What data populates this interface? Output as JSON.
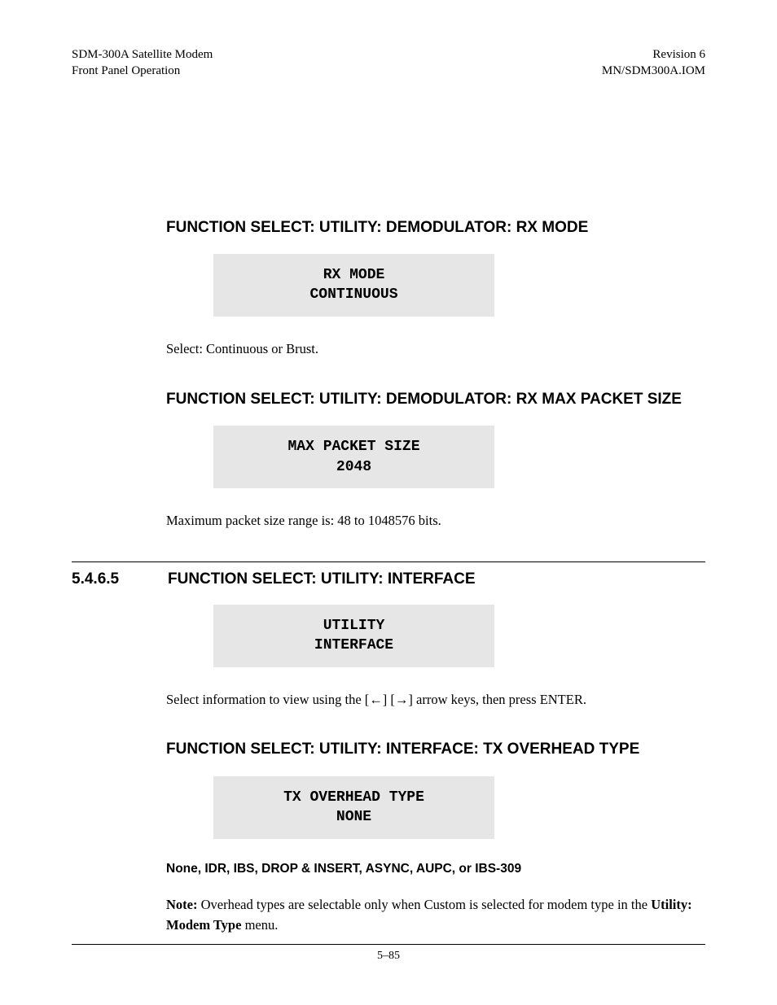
{
  "header": {
    "left1": "SDM-300A Satellite Modem",
    "left2": "Front Panel Operation",
    "right1": "Revision 6",
    "right2": "MN/SDM300A.IOM"
  },
  "section1": {
    "heading": "FUNCTION SELECT: UTILITY: DEMODULATOR: RX MODE",
    "lcd1": "RX MODE",
    "lcd2": "CONTINUOUS",
    "body": "Select: Continuous or Brust."
  },
  "section2": {
    "heading": "FUNCTION SELECT: UTILITY: DEMODULATOR: RX MAX PACKET SIZE",
    "lcd1": "MAX PACKET SIZE",
    "lcd2": "2048",
    "body": "Maximum packet size range is: 48 to 1048576 bits."
  },
  "section3": {
    "number": "5.4.6.5",
    "heading": "FUNCTION SELECT: UTILITY: INTERFACE",
    "lcd1": "UTILITY",
    "lcd2": "INTERFACE",
    "body_before": "Select information to view using the [",
    "body_arrow1": "←",
    "body_mid": "] [",
    "body_arrow2": "→",
    "body_after": "] arrow keys, then press ENTER."
  },
  "section4": {
    "heading": "FUNCTION SELECT: UTILITY: INTERFACE: TX OVERHEAD TYPE",
    "lcd1": "TX OVERHEAD TYPE",
    "lcd2": "NONE",
    "options": "None, IDR, IBS, DROP & INSERT, ASYNC, AUPC, or IBS-309",
    "note_label": "Note:",
    "note_body1": " Overhead types are selectable only when Custom is selected for modem type in the ",
    "note_bold": "Utility: Modem Type",
    "note_body2": " menu."
  },
  "footer": "5–85"
}
